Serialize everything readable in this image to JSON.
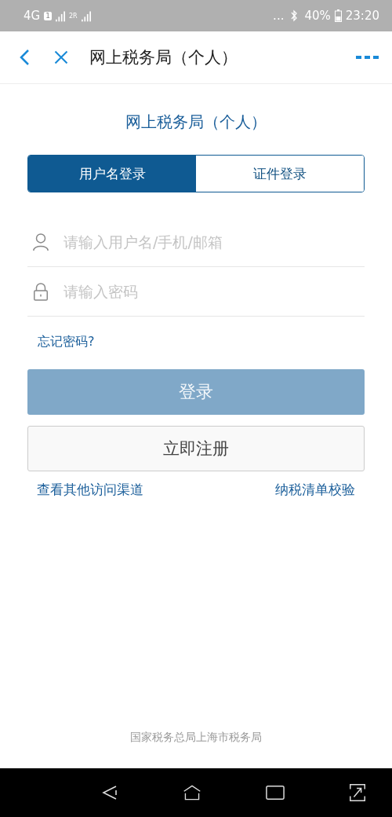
{
  "status_bar": {
    "network": "4G",
    "sim_badge": "1",
    "sim2_label": "2R",
    "more": "...",
    "battery_percent": "40%",
    "time": "23:20"
  },
  "header": {
    "title": "网上税务局（个人）"
  },
  "page_title": "网上税务局（个人）",
  "tabs": [
    {
      "label": "用户名登录",
      "selected": true
    },
    {
      "label": "证件登录",
      "selected": false
    }
  ],
  "fields": [
    {
      "kind": "user",
      "placeholder": "请输入用户名/手机/邮箱"
    },
    {
      "kind": "password",
      "placeholder": "请输入密码"
    }
  ],
  "forgot_link": "忘记密码?",
  "login_button": {
    "label": "登录",
    "disabled": true
  },
  "register_button": "立即注册",
  "links": [
    "查看其他访问渠道",
    "纳税清单校验"
  ],
  "footer": "国家税务总局上海市税务局"
}
